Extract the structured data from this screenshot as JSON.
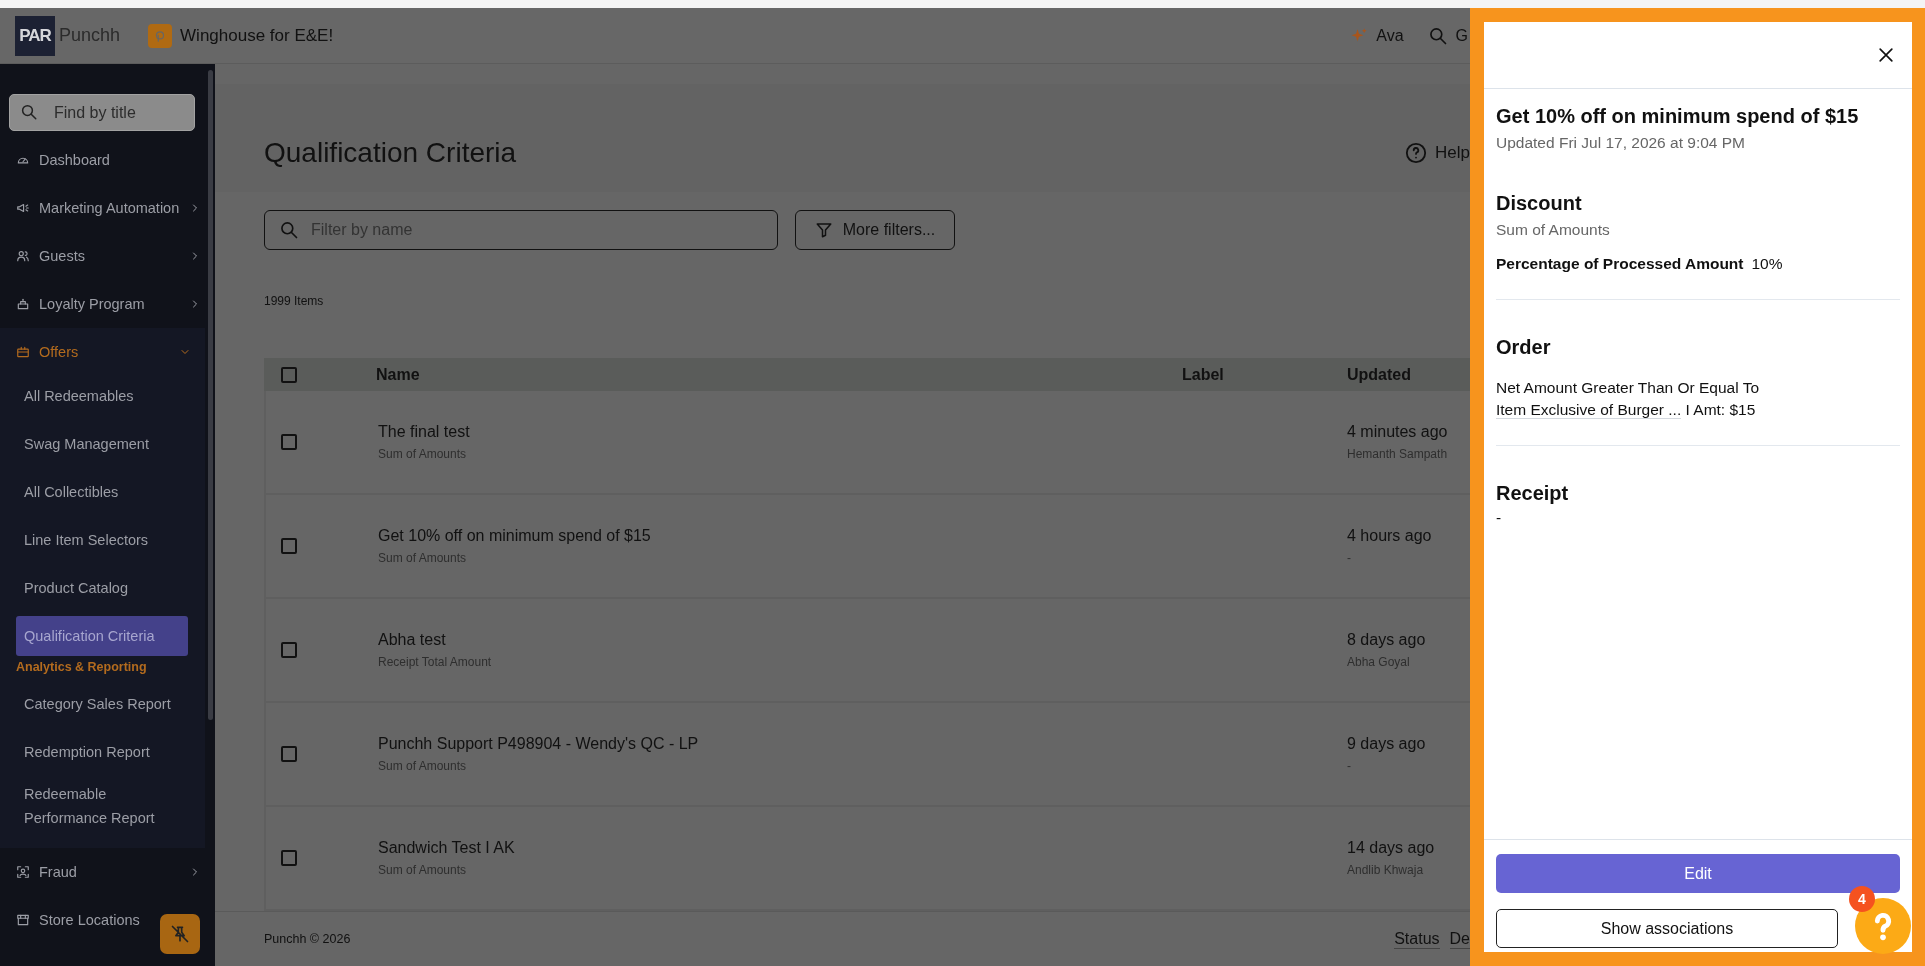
{
  "header": {
    "logo_text": "PAR",
    "brand": "Punchh",
    "business": "Winghouse for E&E!",
    "user": "Ava",
    "search_label": "G"
  },
  "sidebar": {
    "search_placeholder": "Find by title",
    "items": [
      {
        "kind": "link",
        "label": "Dashboard"
      },
      {
        "kind": "group",
        "label": "Marketing Automation",
        "expanded": false
      },
      {
        "kind": "group",
        "label": "Guests",
        "expanded": false
      },
      {
        "kind": "group",
        "label": "Loyalty Program",
        "expanded": false
      },
      {
        "kind": "group",
        "label": "Offers",
        "expanded": true,
        "children": [
          {
            "kind": "link",
            "label": "All Redeemables",
            "selected": false
          },
          {
            "kind": "link",
            "label": "Swag Management",
            "selected": false
          },
          {
            "kind": "link",
            "label": "All Collectibles",
            "selected": false
          },
          {
            "kind": "link",
            "label": "Line Item Selectors",
            "selected": false
          },
          {
            "kind": "link",
            "label": "Product Catalog",
            "selected": false
          },
          {
            "kind": "link",
            "label": "Qualification Criteria",
            "selected": true
          },
          {
            "kind": "heading",
            "label": "Analytics & Reporting"
          },
          {
            "kind": "link",
            "label": "Category Sales Report",
            "selected": false
          },
          {
            "kind": "link",
            "label": "Redemption Report",
            "selected": false
          },
          {
            "kind": "link",
            "label": "Redeemable Performance Report",
            "selected": false
          }
        ]
      },
      {
        "kind": "group",
        "label": "Fraud",
        "expanded": false
      },
      {
        "kind": "group",
        "label": "Store Locations",
        "expanded": false
      }
    ]
  },
  "page": {
    "title": "Qualification Criteria",
    "help_label": "Help",
    "filter_placeholder": "Filter by name",
    "more_filters": "More filters...",
    "item_count": "1999 Items",
    "table": {
      "columns": [
        "Name",
        "Label",
        "Updated"
      ],
      "all_checked": false,
      "rows": [
        {
          "name": "The final test",
          "subtitle": "Sum of Amounts",
          "updated": "4 minutes ago",
          "updated_by": "Hemanth Sampath",
          "checked": false
        },
        {
          "name": "Get 10% off on minimum spend of $15",
          "subtitle": "Sum of Amounts",
          "updated": "4 hours ago",
          "updated_by": "-",
          "checked": false
        },
        {
          "name": "Abha test",
          "subtitle": "Receipt Total Amount",
          "updated": "8 days ago",
          "updated_by": "Abha Goyal",
          "checked": false
        },
        {
          "name": "Punchh Support P498904 - Wendy's QC - LP",
          "subtitle": "Sum of Amounts",
          "updated": "9 days ago",
          "updated_by": "-",
          "checked": false
        },
        {
          "name": "Sandwich Test I AK",
          "subtitle": "Sum of Amounts",
          "updated": "14 days ago",
          "updated_by": "Andlib Khwaja",
          "checked": false
        }
      ]
    },
    "footer": {
      "copyright": "Punchh © 2026",
      "links": [
        "Status",
        "De"
      ]
    }
  },
  "drawer": {
    "title": "Get 10% off on minimum spend of $15",
    "updated": "Updated Fri Jul 17, 2026 at 9:04 PM",
    "sections": [
      {
        "heading": "Discount",
        "subtitle": "Sum of Amounts",
        "fields": [
          {
            "label": "Percentage of Processed Amount",
            "value": "10%"
          }
        ]
      },
      {
        "heading": "Order",
        "lines": [
          {
            "kind": "text",
            "text": "Net Amount Greater Than Or Equal To"
          },
          {
            "kind": "link",
            "link": "Item Exclusive of Burger ...",
            "text": "I Amt: $15"
          }
        ]
      },
      {
        "heading": "Receipt",
        "lines": [
          {
            "kind": "text",
            "text": "-"
          }
        ]
      }
    ],
    "edit_label": "Edit",
    "associations_label": "Show associations",
    "help_badge": "4"
  }
}
